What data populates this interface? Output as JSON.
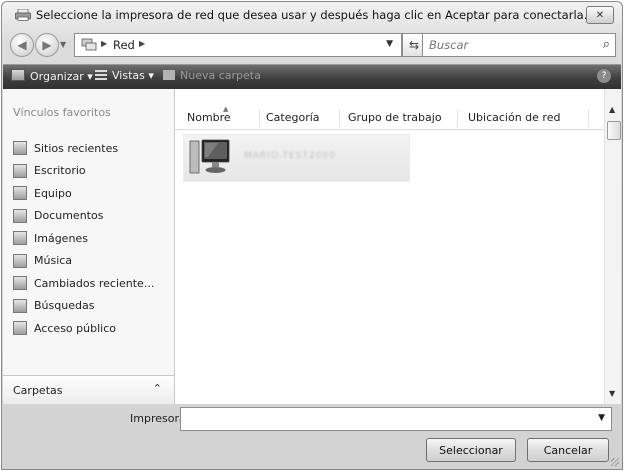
{
  "window": {
    "title": "Seleccione la impresora de red que desea usar y después haga clic en Aceptar para conectarla.",
    "close_label": "✕"
  },
  "address": {
    "breadcrumb": "Red",
    "search_placeholder": "Buscar"
  },
  "toolbar": {
    "organize_label": "Organizar",
    "views_label": "Vistas",
    "new_folder_label": "Nueva carpeta",
    "help_label": "?"
  },
  "sidebar": {
    "title": "Vínculos favoritos",
    "items": [
      {
        "label": "Sitios recientes",
        "icon": "recent-places-icon"
      },
      {
        "label": "Escritorio",
        "icon": "desktop-icon"
      },
      {
        "label": "Equipo",
        "icon": "computer-icon"
      },
      {
        "label": "Documentos",
        "icon": "documents-icon"
      },
      {
        "label": "Imágenes",
        "icon": "pictures-icon"
      },
      {
        "label": "Música",
        "icon": "music-icon"
      },
      {
        "label": "Cambiados reciente...",
        "icon": "recently-changed-icon"
      },
      {
        "label": "Búsquedas",
        "icon": "searches-icon"
      },
      {
        "label": "Acceso público",
        "icon": "public-icon"
      }
    ],
    "folders_label": "Carpetas"
  },
  "list": {
    "columns": [
      "Nombre",
      "Categoría",
      "Grupo de trabajo",
      "Ubicación de red"
    ],
    "items": [
      {
        "name": "MARIO-TEST2000",
        "icon": "computer-icon"
      }
    ]
  },
  "footer": {
    "printer_label": "Impresora",
    "printer_value": "",
    "select_label": "Seleccionar",
    "cancel_label": "Cancelar"
  }
}
